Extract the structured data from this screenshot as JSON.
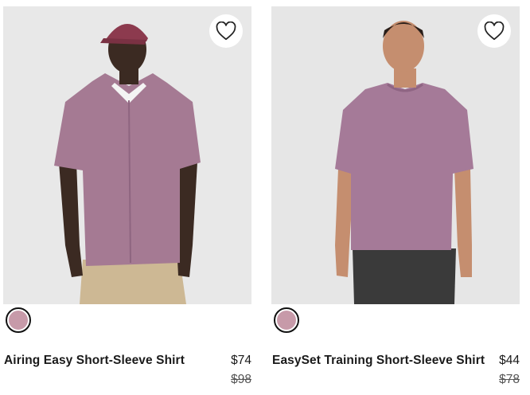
{
  "products": [
    {
      "name": "Airing Easy Short-Sleeve Shirt",
      "price": "$74",
      "original_price": "$98",
      "swatch_color": "#c79aa9",
      "favorite_icon": "heart-outline-icon"
    },
    {
      "name": "EasySet Training Short-Sleeve Shirt",
      "price": "$44",
      "original_price": "$78",
      "swatch_color": "#c79aa9",
      "favorite_icon": "heart-outline-icon"
    }
  ]
}
